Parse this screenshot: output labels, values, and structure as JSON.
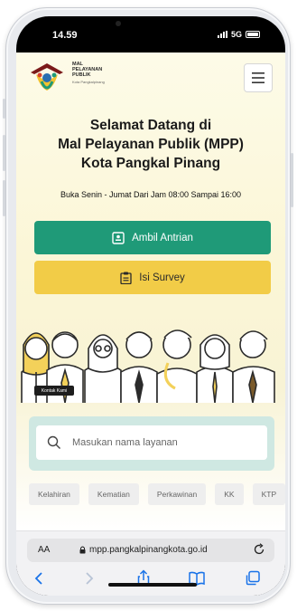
{
  "status_bar": {
    "time": "14.59",
    "network": "5G"
  },
  "site": {
    "logo_lines": [
      "MAL",
      "PELAYANAN",
      "PUBLIK"
    ],
    "logo_sub": "Kota Pangkalpinang",
    "menu_icon": "hamburger-menu-icon"
  },
  "hero": {
    "line1": "Selamat Datang di",
    "line2": "Mal Pelayanan Publik (MPP)",
    "line3": "Kota Pangkal Pinang",
    "hours": "Buka Senin - Jumat Dari Jam 08:00 Sampai 16:00"
  },
  "buttons": {
    "antrian_label": "Ambil Antrian",
    "survey_label": "Isi Survey"
  },
  "illustration": {
    "badge_text": "Kontak Kami"
  },
  "search": {
    "placeholder": "Masukan nama layanan",
    "value": ""
  },
  "categories": [
    "Kelahiran",
    "Kematian",
    "Perkawinan",
    "KK",
    "KTP"
  ],
  "browser": {
    "aa": "AA",
    "url": "mpp.pangkalpinangkota.go.id"
  },
  "colors": {
    "primary_green": "#1f9a78",
    "survey_yellow": "#f2cc47",
    "search_panel": "#cfe8e2"
  }
}
